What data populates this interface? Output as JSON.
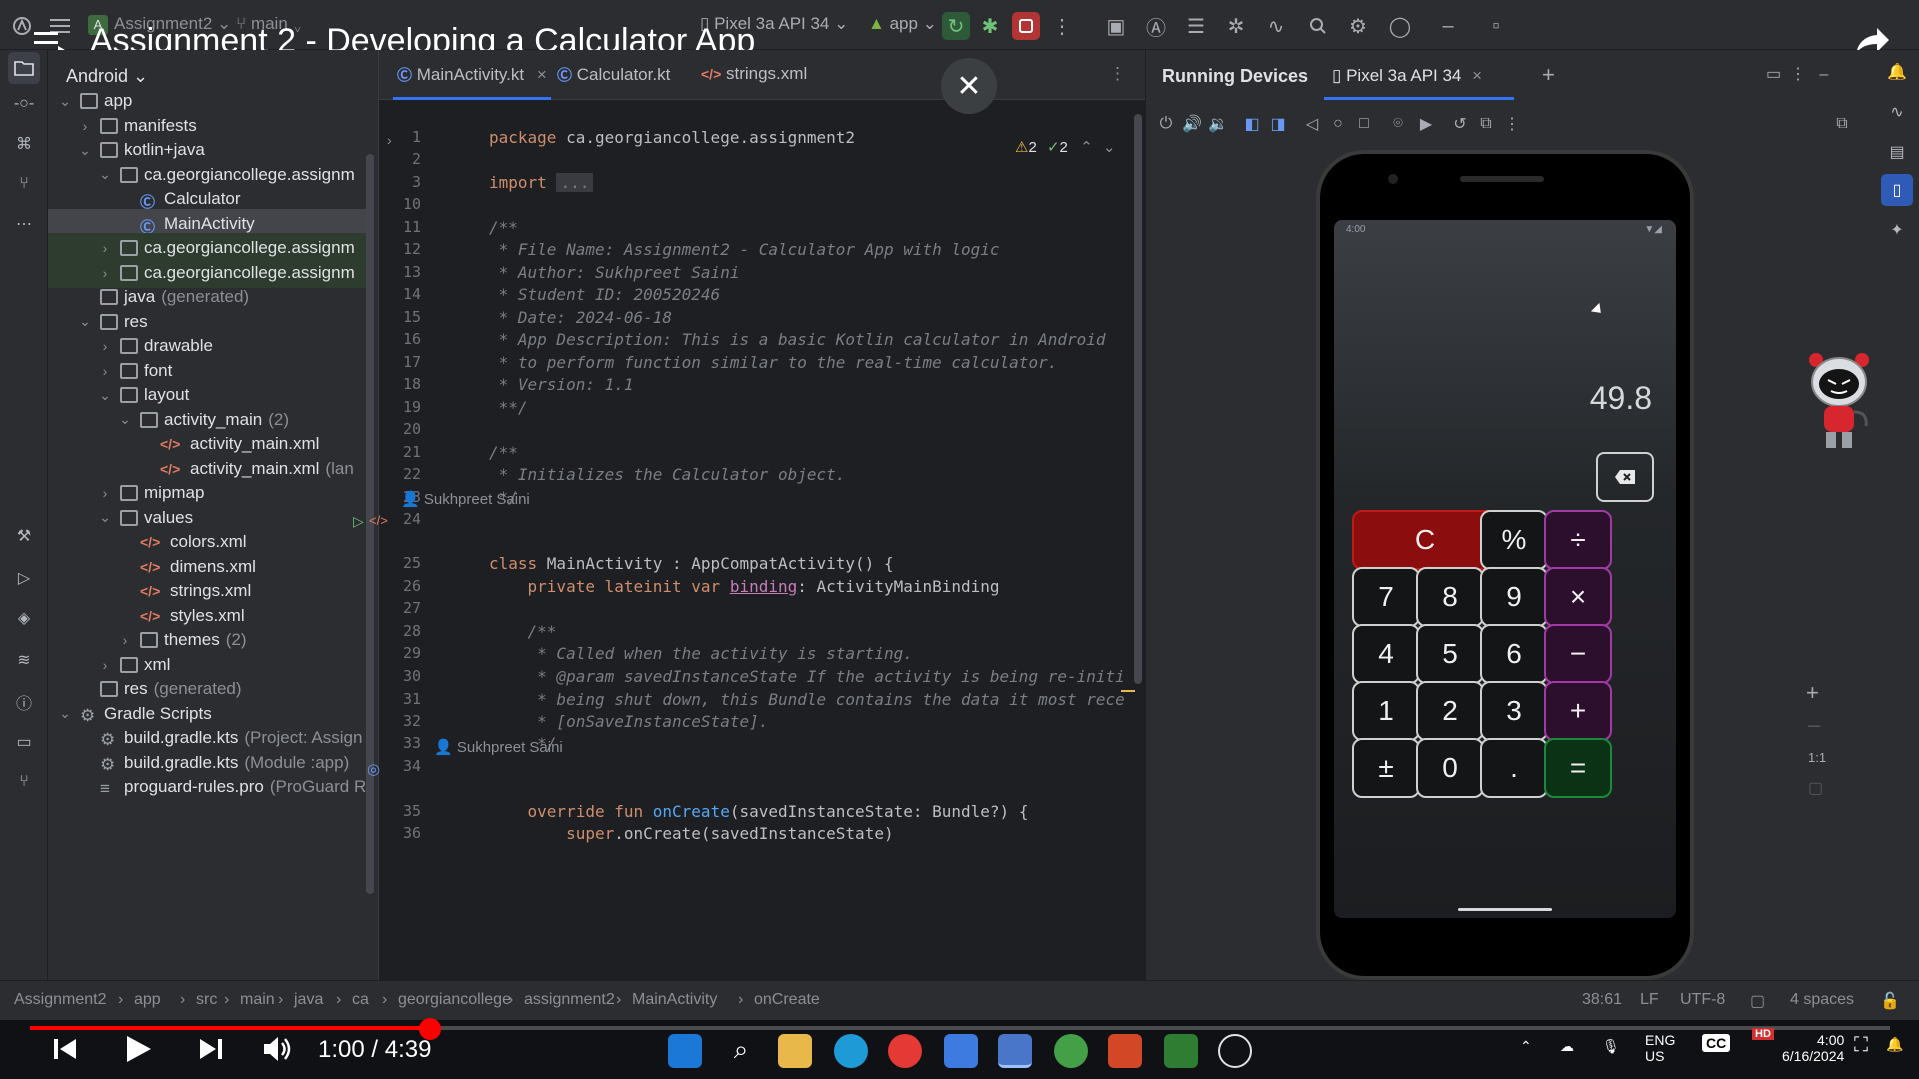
{
  "video": {
    "title": "Assignment 2 - Developing a Calculator App",
    "time": "1:00 / 4:39",
    "progress": 0.215
  },
  "toolbar": {
    "project_name": "Assignment2",
    "branch": "main",
    "device": "Pixel 3a API 34",
    "run_config": "app",
    "project_badge": "A"
  },
  "project_panel": {
    "view": "Android",
    "rows": [
      {
        "label": "app",
        "meta": "",
        "kind": "folder",
        "depth": 0,
        "arrow": "open"
      },
      {
        "label": "manifests",
        "meta": "",
        "kind": "folder",
        "depth": 1,
        "arrow": "closed"
      },
      {
        "label": "kotlin+java",
        "meta": "",
        "kind": "folder",
        "depth": 1,
        "arrow": "open"
      },
      {
        "label": "ca.georgiancollege.assignm",
        "meta": "",
        "kind": "folder",
        "depth": 2,
        "arrow": "open"
      },
      {
        "label": "Calculator",
        "meta": "",
        "kind": "kt",
        "depth": 3,
        "arrow": ""
      },
      {
        "label": "MainActivity",
        "meta": "",
        "kind": "kt",
        "depth": 3,
        "arrow": "",
        "selected": true
      },
      {
        "label": "ca.georgiancollege.assignm",
        "meta": "",
        "kind": "folder",
        "depth": 2,
        "arrow": "closed",
        "green": true
      },
      {
        "label": "ca.georgiancollege.assignm",
        "meta": "",
        "kind": "folder",
        "depth": 2,
        "arrow": "closed",
        "green": true
      },
      {
        "label": "java",
        "meta": "(generated)",
        "kind": "folder",
        "depth": 1,
        "arrow": ""
      },
      {
        "label": "res",
        "meta": "",
        "kind": "folder",
        "depth": 1,
        "arrow": "open"
      },
      {
        "label": "drawable",
        "meta": "",
        "kind": "folder",
        "depth": 2,
        "arrow": "closed"
      },
      {
        "label": "font",
        "meta": "",
        "kind": "folder",
        "depth": 2,
        "arrow": "closed"
      },
      {
        "label": "layout",
        "meta": "",
        "kind": "folder",
        "depth": 2,
        "arrow": "open"
      },
      {
        "label": "activity_main",
        "meta": "(2)",
        "kind": "folder",
        "depth": 3,
        "arrow": "open"
      },
      {
        "label": "activity_main.xml",
        "meta": "",
        "kind": "xml",
        "depth": 4,
        "arrow": ""
      },
      {
        "label": "activity_main.xml",
        "meta": "(lan",
        "kind": "xml",
        "depth": 4,
        "arrow": ""
      },
      {
        "label": "mipmap",
        "meta": "",
        "kind": "folder",
        "depth": 2,
        "arrow": "closed"
      },
      {
        "label": "values",
        "meta": "",
        "kind": "folder",
        "depth": 2,
        "arrow": "open"
      },
      {
        "label": "colors.xml",
        "meta": "",
        "kind": "xml",
        "depth": 3,
        "arrow": ""
      },
      {
        "label": "dimens.xml",
        "meta": "",
        "kind": "xml",
        "depth": 3,
        "arrow": ""
      },
      {
        "label": "strings.xml",
        "meta": "",
        "kind": "xml",
        "depth": 3,
        "arrow": ""
      },
      {
        "label": "styles.xml",
        "meta": "",
        "kind": "xml",
        "depth": 3,
        "arrow": ""
      },
      {
        "label": "themes",
        "meta": "(2)",
        "kind": "folder",
        "depth": 3,
        "arrow": "closed"
      },
      {
        "label": "xml",
        "meta": "",
        "kind": "folder",
        "depth": 2,
        "arrow": "closed"
      },
      {
        "label": "res",
        "meta": "(generated)",
        "kind": "folder",
        "depth": 1,
        "arrow": ""
      },
      {
        "label": "Gradle Scripts",
        "meta": "",
        "kind": "gradle",
        "depth": 0,
        "arrow": "open"
      },
      {
        "label": "build.gradle.kts",
        "meta": "(Project: Assign",
        "kind": "gradle",
        "depth": 1,
        "arrow": ""
      },
      {
        "label": "build.gradle.kts",
        "meta": "(Module :app)",
        "kind": "gradle",
        "depth": 1,
        "arrow": ""
      },
      {
        "label": "proguard-rules.pro",
        "meta": "(ProGuard R",
        "kind": "file",
        "depth": 1,
        "arrow": ""
      }
    ]
  },
  "editor": {
    "tabs": [
      "MainActivity.kt",
      "Calculator.kt",
      "strings.xml"
    ],
    "warnings": "2",
    "checks": "2",
    "lines": [
      {
        "n": "1",
        "parts": [
          [
            "kw",
            "package "
          ],
          [
            "tx",
            "ca.georgiancollege.assignment2"
          ]
        ]
      },
      {
        "n": "2",
        "parts": []
      },
      {
        "n": "3",
        "parts": [
          [
            "kw",
            "import "
          ],
          [
            "cm",
            "..."
          ]
        ]
      },
      {
        "n": "10",
        "parts": []
      },
      {
        "n": "11",
        "parts": [
          [
            "cm",
            "/**"
          ]
        ]
      },
      {
        "n": "12",
        "parts": [
          [
            "cm",
            " * File Name: Assignment2 - Calculator App with logic"
          ]
        ]
      },
      {
        "n": "13",
        "parts": [
          [
            "cm",
            " * Author: Sukhpreet Saini"
          ]
        ]
      },
      {
        "n": "14",
        "parts": [
          [
            "cm",
            " * Student ID: 200520246"
          ]
        ]
      },
      {
        "n": "15",
        "parts": [
          [
            "cm",
            " * Date: 2024-06-18"
          ]
        ]
      },
      {
        "n": "16",
        "parts": [
          [
            "cm",
            " * App Description: This is a basic Kotlin calculator in Android"
          ]
        ]
      },
      {
        "n": "17",
        "parts": [
          [
            "cm",
            " * to perform function similar to the real-time calculator."
          ]
        ]
      },
      {
        "n": "18",
        "parts": [
          [
            "cm",
            " * Version: 1.1"
          ]
        ]
      },
      {
        "n": "19",
        "parts": [
          [
            "cm",
            " **/"
          ]
        ]
      },
      {
        "n": "20",
        "parts": []
      },
      {
        "n": "21",
        "parts": [
          [
            "cm",
            "/**"
          ]
        ]
      },
      {
        "n": "22",
        "parts": [
          [
            "cm",
            " * Initializes the Calculator object."
          ]
        ]
      },
      {
        "n": "23",
        "parts": [
          [
            "cm",
            " */"
          ]
        ]
      },
      {
        "n": "24",
        "parts": []
      },
      {
        "n": "25",
        "parts": [
          [
            "kw",
            "class "
          ],
          [
            "tx",
            "MainActivity : AppCompatActivity() {"
          ]
        ]
      },
      {
        "n": "26",
        "parts": [
          [
            "tx",
            "    "
          ],
          [
            "kw",
            "private lateinit var "
          ],
          [
            "pr",
            "binding"
          ],
          [
            "tx",
            ": ActivityMainBinding"
          ]
        ]
      },
      {
        "n": "27",
        "parts": []
      },
      {
        "n": "28",
        "parts": [
          [
            "cm",
            "    /**"
          ]
        ]
      },
      {
        "n": "29",
        "parts": [
          [
            "cm",
            "     * Called when the activity is starting."
          ]
        ]
      },
      {
        "n": "30",
        "parts": [
          [
            "cm",
            "     * @param savedInstanceState If the activity is being re-initi"
          ]
        ]
      },
      {
        "n": "31",
        "parts": [
          [
            "cm",
            "     * being shut down, this Bundle contains the data it most rece"
          ]
        ]
      },
      {
        "n": "32",
        "parts": [
          [
            "cm",
            "     * [onSaveInstanceState]."
          ]
        ]
      },
      {
        "n": "33",
        "parts": [
          [
            "cm",
            "     */"
          ]
        ]
      },
      {
        "n": "34",
        "parts": []
      },
      {
        "n": "35",
        "parts": [
          [
            "tx",
            "    "
          ],
          [
            "kw",
            "override fun "
          ],
          [
            "fn",
            "onCreate"
          ],
          [
            "tx",
            "(savedInstanceState: Bundle?) {"
          ]
        ]
      },
      {
        "n": "36",
        "parts": [
          [
            "tx",
            "        "
          ],
          [
            "kw",
            "super"
          ],
          [
            "tx",
            ".onCreate(savedInstanceState)"
          ]
        ]
      }
    ],
    "author_hints": [
      "Sukhpreet Saini",
      "Sukhpreet Saini"
    ]
  },
  "devices": {
    "title": "Running Devices",
    "tab": "Pixel 3a API 34",
    "zoom_label": "1:1"
  },
  "calculator": {
    "display": "49.8",
    "status_time": "4:00",
    "rows": [
      [
        "C",
        "%",
        "÷"
      ],
      [
        "7",
        "8",
        "9",
        "×"
      ],
      [
        "4",
        "5",
        "6",
        "−"
      ],
      [
        "1",
        "2",
        "3",
        "+"
      ],
      [
        "±",
        "0",
        ".",
        "="
      ]
    ]
  },
  "statusbar": {
    "breadcrumbs": [
      "Assignment2",
      "app",
      "src",
      "main",
      "java",
      "ca",
      "georgiancollege",
      "assignment2",
      "MainActivity",
      "onCreate"
    ],
    "position": "38:61",
    "line_sep": "LF",
    "encoding": "UTF-8",
    "indent": "4 spaces"
  },
  "taskbar": {
    "lang": "ENG",
    "region": "US",
    "clock": "4:00",
    "date": "6/16/2024"
  }
}
